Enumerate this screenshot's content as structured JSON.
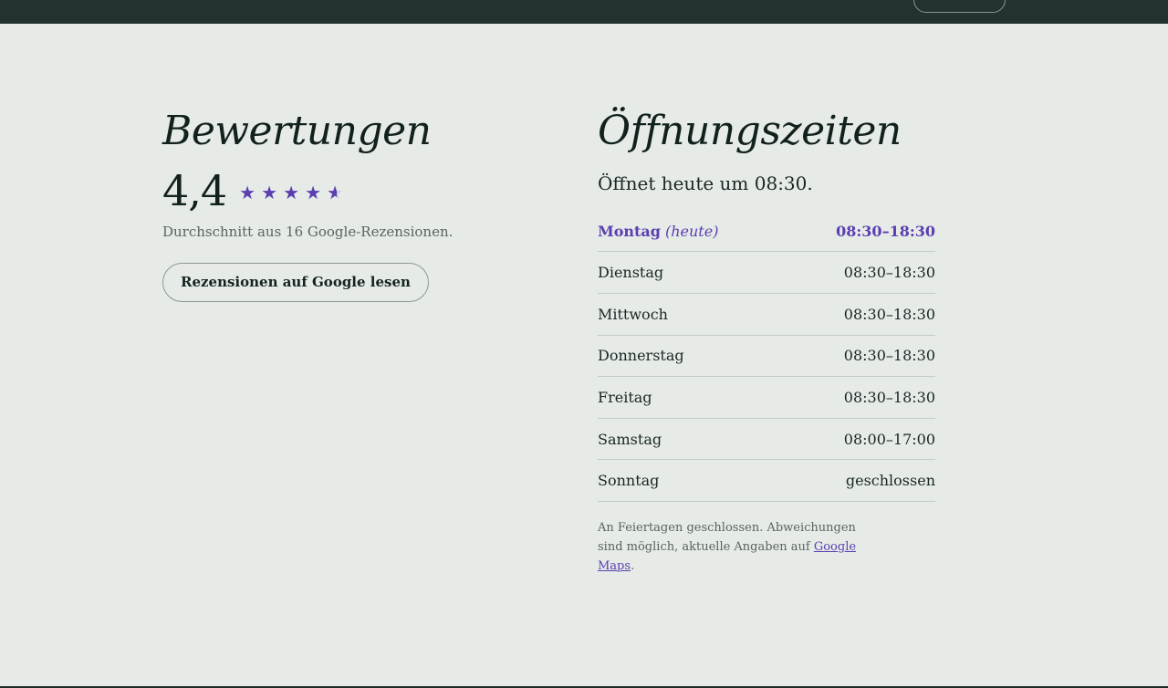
{
  "reviews": {
    "title": "Bewertungen",
    "rating": "4,4",
    "stars": {
      "value": 4.4,
      "max": 5
    },
    "subtitle": "Durchschnitt aus 16 Google-Rezensionen.",
    "button_label": "Rezensionen auf Google lesen"
  },
  "hours": {
    "title": "Öffnungszeiten",
    "open_today": "Öffnet heute um 08:30.",
    "today_note": "(heute)",
    "days": [
      {
        "day": "Montag",
        "time": "08:30–18:30",
        "today": true
      },
      {
        "day": "Dienstag",
        "time": "08:30–18:30"
      },
      {
        "day": "Mittwoch",
        "time": "08:30–18:30"
      },
      {
        "day": "Donnerstag",
        "time": "08:30–18:30"
      },
      {
        "day": "Freitag",
        "time": "08:30–18:30"
      },
      {
        "day": "Samstag",
        "time": "08:00–17:00"
      },
      {
        "day": "Sonntag",
        "time": "geschlossen"
      }
    ],
    "footnote_text": "An Feiertagen geschlossen. Abweichungen sind möglich, aktuelle Angaben auf ",
    "footnote_link": "Google Maps",
    "footnote_end": "."
  },
  "colors": {
    "accent": "#5b3fb0",
    "background": "#e6ebe7",
    "topbar": "#233230"
  },
  "icons": {
    "star": "star-icon"
  }
}
